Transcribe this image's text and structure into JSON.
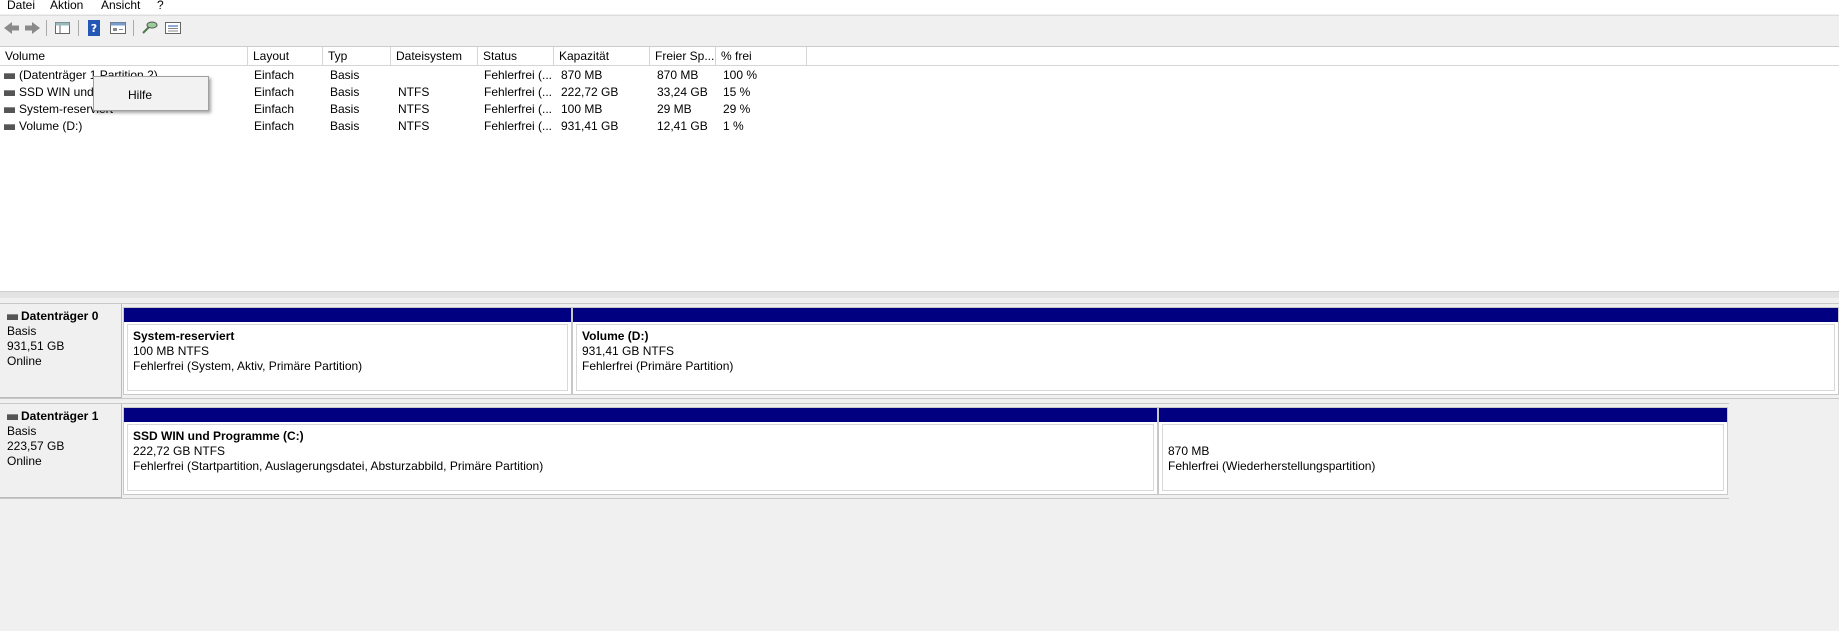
{
  "menu": [
    "Datei",
    "Aktion",
    "Ansicht",
    "?"
  ],
  "toolbar": {
    "icons": [
      "back-arrow-icon",
      "forward-arrow-icon",
      "console-tree-icon",
      "help-icon",
      "properties-icon",
      "connect-icon",
      "list-view-icon"
    ]
  },
  "columns": [
    "Volume",
    "Layout",
    "Typ",
    "Dateisystem",
    "Status",
    "Kapazität",
    "Freier Sp...",
    "% frei"
  ],
  "volumes": [
    {
      "name": "(Datenträger 1 Partition 2)",
      "layout": "Einfach",
      "type": "Basis",
      "fs": "",
      "status": "Fehlerfrei (...",
      "capacity": "870 MB",
      "free": "870 MB",
      "pct": "100 %"
    },
    {
      "name": "SSD WIN und",
      "layout": "Einfach",
      "type": "Basis",
      "fs": "NTFS",
      "status": "Fehlerfrei (...",
      "capacity": "222,72 GB",
      "free": "33,24 GB",
      "pct": "15 %"
    },
    {
      "name": "System-reserviert",
      "layout": "Einfach",
      "type": "Basis",
      "fs": "NTFS",
      "status": "Fehlerfrei (...",
      "capacity": "100 MB",
      "free": "29 MB",
      "pct": "29 %"
    },
    {
      "name": "Volume (D:)",
      "layout": "Einfach",
      "type": "Basis",
      "fs": "NTFS",
      "status": "Fehlerfrei (...",
      "capacity": "931,41 GB",
      "free": "12,41 GB",
      "pct": "1 %"
    }
  ],
  "context_menu": {
    "item": "Hilfe"
  },
  "disks": [
    {
      "name": "Datenträger 0",
      "type": "Basis",
      "size": "931,51 GB",
      "state": "Online",
      "partitions": [
        {
          "title": "System-reserviert",
          "size": "100 MB NTFS",
          "status": "Fehlerfrei (System, Aktiv, Primäre Partition)"
        },
        {
          "title": "Volume  (D:)",
          "size": "931,41 GB NTFS",
          "status": "Fehlerfrei (Primäre Partition)"
        }
      ]
    },
    {
      "name": "Datenträger 1",
      "type": "Basis",
      "size": "223,57 GB",
      "state": "Online",
      "partitions": [
        {
          "title": "SSD WIN und Programme  (C:)",
          "size": "222,72 GB NTFS",
          "status": "Fehlerfrei (Startpartition, Auslagerungsdatei, Absturzabbild, Primäre Partition)"
        },
        {
          "title": "",
          "size": "870 MB",
          "status": "Fehlerfrei (Wiederherstellungspartition)"
        }
      ]
    }
  ],
  "colors": {
    "partition_bar": "#000080",
    "background": "#f0f0f0"
  }
}
